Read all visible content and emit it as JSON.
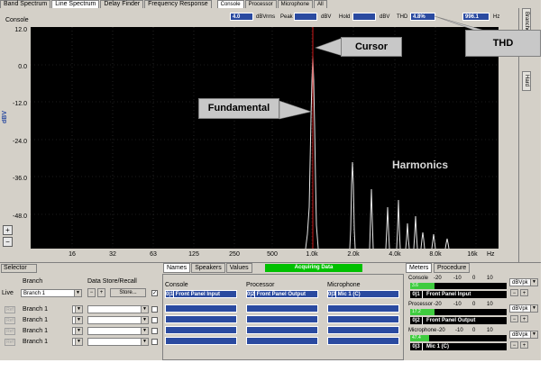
{
  "tabs": [
    "Band Spectrum",
    "Line Spectrum",
    "Delay Finder",
    "Frequency Response"
  ],
  "sources": [
    "Console",
    "Processor",
    "Microphone",
    "All"
  ],
  "right_tabs": [
    "Branches",
    "Hard"
  ],
  "readouts": {
    "value1": "4.0",
    "unit1": "dBVrms",
    "peak_label": "Peak",
    "peak_unit": "dBV",
    "hold_label": "Hold",
    "hold_unit": "dBV",
    "thd_label": "THD",
    "thd_value": "4.8%",
    "freq_value": "996.1",
    "freq_unit": "Hz"
  },
  "plot": {
    "title": "Console",
    "ylabel": "dBV",
    "yticks": [
      "12.0",
      "0.0",
      "-12.0",
      "-24.0",
      "-36.0",
      "-48.0"
    ],
    "xticks": [
      "16",
      "32",
      "63",
      "125",
      "250",
      "500",
      "1.0k",
      "2.0k",
      "4.0k",
      "8.0k",
      "16k"
    ],
    "xunit": "Hz",
    "zoom_in": "+",
    "zoom_out": "−"
  },
  "annotations": {
    "cursor": "Cursor",
    "thd": "THD",
    "fundamental": "Fundamental",
    "harmonics": "Harmonics"
  },
  "colors": {
    "accent": "#2a4aa0",
    "acquiring": "#00c000",
    "cursor": "#d01818"
  },
  "selector": {
    "title": "Selector",
    "branch_label": "Branch",
    "store_label": "Data Store/Recall",
    "live_label": "Live",
    "live_branch": "Branch 1",
    "minus": "−",
    "plus": "+",
    "store_button": "Store...",
    "check": "✓",
    "ref_label": "Ref",
    "rows": [
      "Branch 1",
      "Branch 1",
      "Branch 1",
      "Branch 1"
    ]
  },
  "mid": {
    "tabs": [
      "Names",
      "Speakers",
      "Values"
    ],
    "status": "Acquiring Data",
    "columns": [
      {
        "header": "Console",
        "num": "0|1",
        "name": "Front Panel Input"
      },
      {
        "header": "Processor",
        "num": "0|2",
        "name": "Front Panel Output"
      },
      {
        "header": "Microphone",
        "num": "0|3",
        "name": "Mic 1 (C)"
      }
    ]
  },
  "meters": {
    "tabs": [
      "Meters",
      "Procedure"
    ],
    "scale": [
      "-20",
      "-10",
      "0",
      "10"
    ],
    "channels": [
      {
        "title": "Console",
        "num": "0|1",
        "name": "Front Panel Input",
        "value": "3.6",
        "level": 0.25,
        "unit": "dBVpk"
      },
      {
        "title": "Processor",
        "num": "0|2",
        "name": "Front Panel Output",
        "value": "17.2",
        "level": 0.25,
        "unit": "dBVpk"
      },
      {
        "title": "Microphone",
        "num": "0|3",
        "name": "Mic 1 (C)",
        "value": "47.4",
        "level": 0.2,
        "unit": "dBVpk"
      }
    ],
    "minus": "−",
    "plus": "+"
  }
}
